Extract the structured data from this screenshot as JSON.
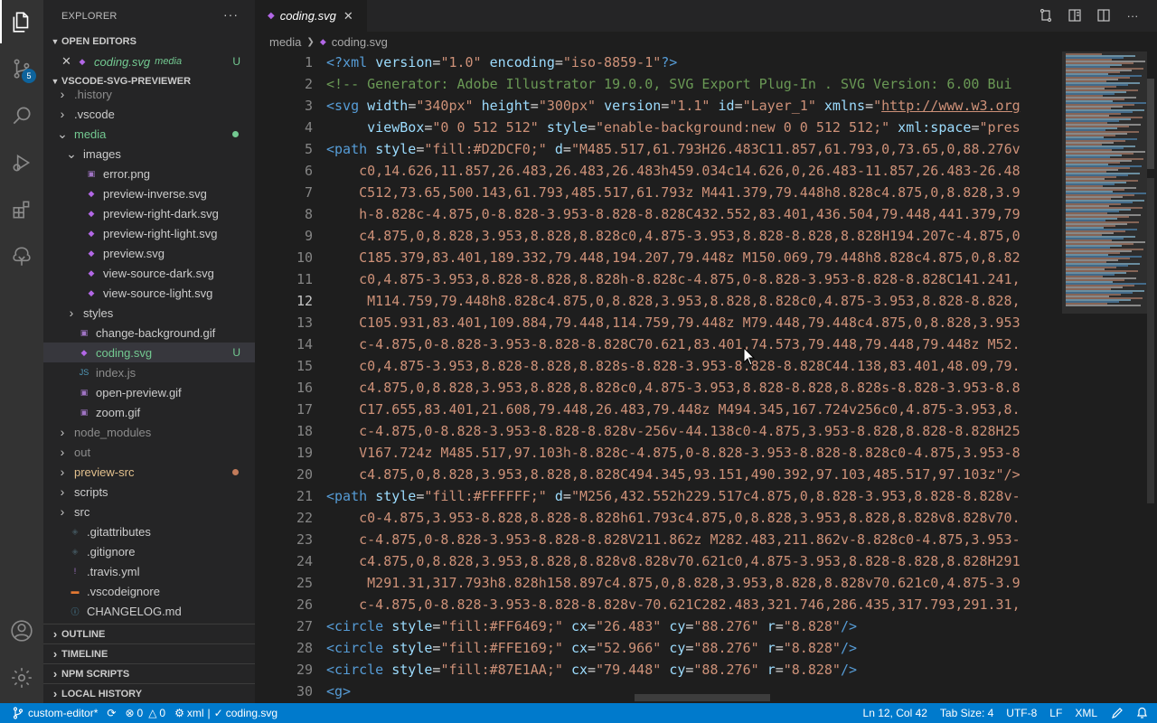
{
  "activity_bar": {
    "items": [
      {
        "icon": "files-icon",
        "active": true
      },
      {
        "icon": "source-control-icon",
        "badge": "5"
      },
      {
        "icon": "search-icon"
      },
      {
        "icon": "run-debug-icon"
      },
      {
        "icon": "extensions-icon"
      },
      {
        "icon": "remote-tree-icon"
      }
    ],
    "bottom": [
      {
        "icon": "account-icon"
      },
      {
        "icon": "settings-gear-icon"
      }
    ]
  },
  "sidebar": {
    "title": "EXPLORER",
    "more": "···",
    "open_editors": {
      "label": "OPEN EDITORS",
      "items": [
        {
          "name": "coding.svg",
          "folder": "media",
          "status": "U"
        }
      ]
    },
    "project": {
      "label": "VSCODE-SVG-PREVIEWER",
      "tree": [
        {
          "name": ".history",
          "type": "folder",
          "depth": 1,
          "color": "ignored"
        },
        {
          "name": ".vscode",
          "type": "folder",
          "depth": 1,
          "color": "normal"
        },
        {
          "name": "media",
          "type": "folder-open",
          "depth": 1,
          "color": "media",
          "dot": "#73c991"
        },
        {
          "name": "images",
          "type": "folder-open",
          "depth": 2,
          "color": "normal"
        },
        {
          "name": "error.png",
          "type": "img",
          "depth": 3,
          "color": "normal"
        },
        {
          "name": "preview-inverse.svg",
          "type": "svg",
          "depth": 3,
          "color": "normal"
        },
        {
          "name": "preview-right-dark.svg",
          "type": "svg",
          "depth": 3,
          "color": "normal"
        },
        {
          "name": "preview-right-light.svg",
          "type": "svg",
          "depth": 3,
          "color": "normal"
        },
        {
          "name": "preview.svg",
          "type": "svg",
          "depth": 3,
          "color": "normal"
        },
        {
          "name": "view-source-dark.svg",
          "type": "svg",
          "depth": 3,
          "color": "normal"
        },
        {
          "name": "view-source-light.svg",
          "type": "svg",
          "depth": 3,
          "color": "normal"
        },
        {
          "name": "styles",
          "type": "folder",
          "depth": 2,
          "color": "normal"
        },
        {
          "name": "change-background.gif",
          "type": "img",
          "depth": 2,
          "color": "normal"
        },
        {
          "name": "coding.svg",
          "type": "svg",
          "depth": 2,
          "color": "untracked",
          "status": "U",
          "selected": true
        },
        {
          "name": "index.js",
          "type": "js",
          "depth": 2,
          "color": "ignored"
        },
        {
          "name": "open-preview.gif",
          "type": "img",
          "depth": 2,
          "color": "normal"
        },
        {
          "name": "zoom.gif",
          "type": "img",
          "depth": 2,
          "color": "normal"
        },
        {
          "name": "node_modules",
          "type": "folder",
          "depth": 1,
          "color": "ignored"
        },
        {
          "name": "out",
          "type": "folder",
          "depth": 1,
          "color": "ignored"
        },
        {
          "name": "preview-src",
          "type": "folder",
          "depth": 1,
          "color": "mod",
          "dot": "#c27b5a"
        },
        {
          "name": "scripts",
          "type": "folder",
          "depth": 1,
          "color": "normal"
        },
        {
          "name": "src",
          "type": "folder",
          "depth": 1,
          "color": "normal"
        },
        {
          "name": ".gitattributes",
          "type": "git",
          "depth": 1,
          "color": "normal"
        },
        {
          "name": ".gitignore",
          "type": "git",
          "depth": 1,
          "color": "normal"
        },
        {
          "name": ".travis.yml",
          "type": "yml",
          "depth": 1,
          "color": "normal"
        },
        {
          "name": ".vscodeignore",
          "type": "vsignore",
          "depth": 1,
          "color": "normal"
        },
        {
          "name": "CHANGELOG.md",
          "type": "md",
          "depth": 1,
          "color": "normal"
        }
      ]
    },
    "collapsed_sections": [
      "OUTLINE",
      "TIMELINE",
      "NPM SCRIPTS",
      "LOCAL HISTORY"
    ]
  },
  "tab": {
    "label": "coding.svg",
    "close": "✕"
  },
  "breadcrumb": {
    "folder": "media",
    "file": "coding.svg"
  },
  "editor": {
    "current_line": 12,
    "first_line": 1,
    "lines": [
      [
        [
          "tag",
          "<?xml "
        ],
        [
          "attr",
          "version"
        ],
        [
          "eq",
          "="
        ],
        [
          "str",
          "\"1.0\""
        ],
        [
          "eq",
          " "
        ],
        [
          "attr",
          "encoding"
        ],
        [
          "eq",
          "="
        ],
        [
          "str",
          "\"iso-8859-1\""
        ],
        [
          "tag",
          "?>"
        ]
      ],
      [
        [
          "com",
          "<!-- Generator: Adobe Illustrator 19.0.0, SVG Export Plug-In . SVG Version: 6.00 Bui"
        ]
      ],
      [
        [
          "tag",
          "<svg "
        ],
        [
          "attr",
          "width"
        ],
        [
          "eq",
          "="
        ],
        [
          "str",
          "\"340px\""
        ],
        [
          "eq",
          " "
        ],
        [
          "attr",
          "height"
        ],
        [
          "eq",
          "="
        ],
        [
          "str",
          "\"300px\""
        ],
        [
          "eq",
          " "
        ],
        [
          "attr",
          "version"
        ],
        [
          "eq",
          "="
        ],
        [
          "str",
          "\"1.1\""
        ],
        [
          "eq",
          " "
        ],
        [
          "attr",
          "id"
        ],
        [
          "eq",
          "="
        ],
        [
          "str",
          "\"Layer_1\""
        ],
        [
          "eq",
          " "
        ],
        [
          "attr",
          "xmlns"
        ],
        [
          "eq",
          "="
        ],
        [
          "str",
          "\""
        ],
        [
          "url",
          "http://www.w3.org"
        ]
      ],
      [
        [
          "eq",
          "     "
        ],
        [
          "attr",
          "viewBox"
        ],
        [
          "eq",
          "="
        ],
        [
          "str",
          "\"0 0 512 512\""
        ],
        [
          "eq",
          " "
        ],
        [
          "attr",
          "style"
        ],
        [
          "eq",
          "="
        ],
        [
          "str",
          "\"enable-background:new 0 0 512 512;\""
        ],
        [
          "eq",
          " "
        ],
        [
          "attr",
          "xml:space"
        ],
        [
          "eq",
          "="
        ],
        [
          "str",
          "\"pres"
        ]
      ],
      [
        [
          "tag",
          "<path "
        ],
        [
          "attr",
          "style"
        ],
        [
          "eq",
          "="
        ],
        [
          "str",
          "\"fill:#D2DCF0;\""
        ],
        [
          "eq",
          " "
        ],
        [
          "attr",
          "d"
        ],
        [
          "eq",
          "="
        ],
        [
          "str",
          "\"M485.517,61.793H26.483C11.857,61.793,0,73.65,0,88.276v"
        ]
      ],
      [
        [
          "str",
          "    c0,14.626,11.857,26.483,26.483,26.483h459.034c14.626,0,26.483-11.857,26.483-26.48"
        ]
      ],
      [
        [
          "str",
          "    C512,73.65,500.143,61.793,485.517,61.793z M441.379,79.448h8.828c4.875,0,8.828,3.9"
        ]
      ],
      [
        [
          "str",
          "    h-8.828c-4.875,0-8.828-3.953-8.828-8.828C432.552,83.401,436.504,79.448,441.379,79"
        ]
      ],
      [
        [
          "str",
          "    c4.875,0,8.828,3.953,8.828,8.828c0,4.875-3.953,8.828-8.828,8.828H194.207c-4.875,0"
        ]
      ],
      [
        [
          "str",
          "    C185.379,83.401,189.332,79.448,194.207,79.448z M150.069,79.448h8.828c4.875,0,8.82"
        ]
      ],
      [
        [
          "str",
          "    c0,4.875-3.953,8.828-8.828,8.828h-8.828c-4.875,0-8.828-3.953-8.828-8.828C141.241,"
        ]
      ],
      [
        [
          "str",
          "     M114.759,79.448h8.828c4.875,0,8.828,3.953,8.828,8.828c0,4.875-3.953,8.828-8.828,"
        ]
      ],
      [
        [
          "str",
          "    C105.931,83.401,109.884,79.448,114.759,79.448z M79.448,79.448c4.875,0,8.828,3.953"
        ]
      ],
      [
        [
          "str",
          "    c-4.875,0-8.828-3.953-8.828-8.828C70.621,83.401,74.573,79.448,79.448,79.448z M52."
        ]
      ],
      [
        [
          "str",
          "    c0,4.875-3.953,8.828-8.828,8.828s-8.828-3.953-8.828-8.828C44.138,83.401,48.09,79."
        ]
      ],
      [
        [
          "str",
          "    c4.875,0,8.828,3.953,8.828,8.828c0,4.875-3.953,8.828-8.828,8.828s-8.828-3.953-8.8"
        ]
      ],
      [
        [
          "str",
          "    C17.655,83.401,21.608,79.448,26.483,79.448z M494.345,167.724v256c0,4.875-3.953,8."
        ]
      ],
      [
        [
          "str",
          "    c-4.875,0-8.828-3.953-8.828-8.828v-256v-44.138c0-4.875,3.953-8.828,8.828-8.828H25"
        ]
      ],
      [
        [
          "str",
          "    V167.724z M485.517,97.103h-8.828c-4.875,0-8.828-3.953-8.828-8.828c0-4.875,3.953-8"
        ]
      ],
      [
        [
          "str",
          "    c4.875,0,8.828,3.953,8.828,8.828C494.345,93.151,490.392,97.103,485.517,97.103z\"/>"
        ]
      ],
      [
        [
          "tag",
          "<path "
        ],
        [
          "attr",
          "style"
        ],
        [
          "eq",
          "="
        ],
        [
          "str",
          "\"fill:#FFFFFF;\""
        ],
        [
          "eq",
          " "
        ],
        [
          "attr",
          "d"
        ],
        [
          "eq",
          "="
        ],
        [
          "str",
          "\"M256,432.552h229.517c4.875,0,8.828-3.953,8.828-8.828v-"
        ]
      ],
      [
        [
          "str",
          "    c0-4.875,3.953-8.828,8.828-8.828h61.793c4.875,0,8.828,3.953,8.828,8.828v8.828v70."
        ]
      ],
      [
        [
          "str",
          "    c-4.875,0-8.828-3.953-8.828-8.828V211.862z M282.483,211.862v-8.828c0-4.875,3.953-"
        ]
      ],
      [
        [
          "str",
          "    c4.875,0,8.828,3.953,8.828,8.828v8.828v70.621c0,4.875-3.953,8.828-8.828,8.828H291"
        ]
      ],
      [
        [
          "str",
          "     M291.31,317.793h8.828h158.897c4.875,0,8.828,3.953,8.828,8.828v70.621c0,4.875-3.9"
        ]
      ],
      [
        [
          "str",
          "    c-4.875,0-8.828-3.953-8.828-8.828v-70.621C282.483,321.746,286.435,317.793,291.31,"
        ]
      ],
      [
        [
          "tag",
          "<circle "
        ],
        [
          "attr",
          "style"
        ],
        [
          "eq",
          "="
        ],
        [
          "str",
          "\"fill:#FF6469;\""
        ],
        [
          "eq",
          " "
        ],
        [
          "attr",
          "cx"
        ],
        [
          "eq",
          "="
        ],
        [
          "str",
          "\"26.483\""
        ],
        [
          "eq",
          " "
        ],
        [
          "attr",
          "cy"
        ],
        [
          "eq",
          "="
        ],
        [
          "str",
          "\"88.276\""
        ],
        [
          "eq",
          " "
        ],
        [
          "attr",
          "r"
        ],
        [
          "eq",
          "="
        ],
        [
          "str",
          "\"8.828\""
        ],
        [
          "tag",
          "/>"
        ]
      ],
      [
        [
          "tag",
          "<circle "
        ],
        [
          "attr",
          "style"
        ],
        [
          "eq",
          "="
        ],
        [
          "str",
          "\"fill:#FFE169;\""
        ],
        [
          "eq",
          " "
        ],
        [
          "attr",
          "cx"
        ],
        [
          "eq",
          "="
        ],
        [
          "str",
          "\"52.966\""
        ],
        [
          "eq",
          " "
        ],
        [
          "attr",
          "cy"
        ],
        [
          "eq",
          "="
        ],
        [
          "str",
          "\"88.276\""
        ],
        [
          "eq",
          " "
        ],
        [
          "attr",
          "r"
        ],
        [
          "eq",
          "="
        ],
        [
          "str",
          "\"8.828\""
        ],
        [
          "tag",
          "/>"
        ]
      ],
      [
        [
          "tag",
          "<circle "
        ],
        [
          "attr",
          "style"
        ],
        [
          "eq",
          "="
        ],
        [
          "str",
          "\"fill:#87E1AA;\""
        ],
        [
          "eq",
          " "
        ],
        [
          "attr",
          "cx"
        ],
        [
          "eq",
          "="
        ],
        [
          "str",
          "\"79.448\""
        ],
        [
          "eq",
          " "
        ],
        [
          "attr",
          "cy"
        ],
        [
          "eq",
          "="
        ],
        [
          "str",
          "\"88.276\""
        ],
        [
          "eq",
          " "
        ],
        [
          "attr",
          "r"
        ],
        [
          "eq",
          "="
        ],
        [
          "str",
          "\"8.828\""
        ],
        [
          "tag",
          "/>"
        ]
      ],
      [
        [
          "tag",
          "<g>"
        ]
      ]
    ]
  },
  "status_bar": {
    "branch": "custom-editor*",
    "errors": "0",
    "warnings": "0",
    "language_info": "xml",
    "file_check": "coding.svg",
    "position": "Ln 12, Col 42",
    "tab_size": "Tab Size: 4",
    "encoding": "UTF-8",
    "eol": "LF",
    "language": "XML"
  },
  "colors": {
    "accent": "#007acc",
    "untracked": "#73c991",
    "modified": "#e2c08d",
    "svg_icon": "#b267e6"
  }
}
